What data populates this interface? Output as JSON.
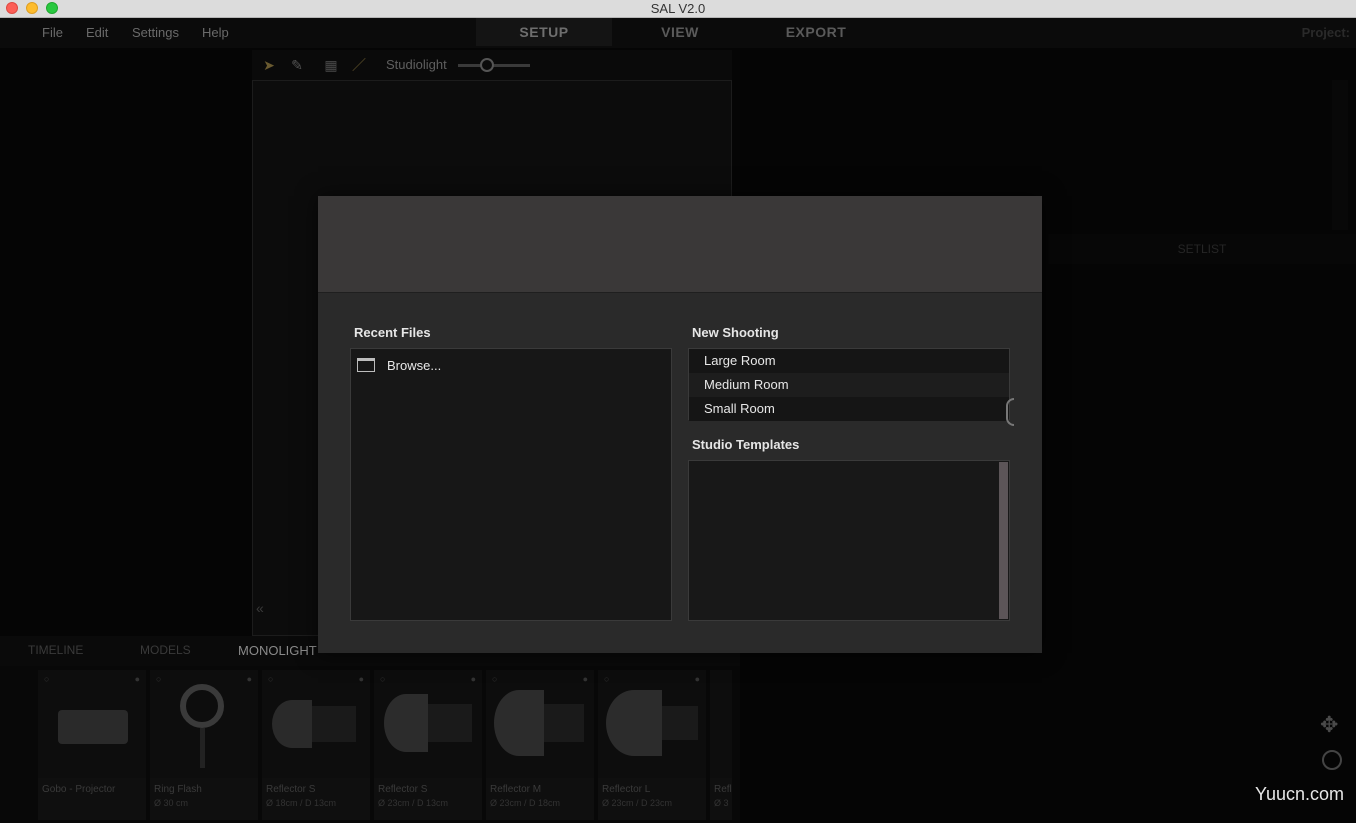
{
  "window": {
    "title": "SAL V2.0"
  },
  "menu": {
    "file": "File",
    "edit": "Edit",
    "settings": "Settings",
    "help": "Help"
  },
  "modes": {
    "setup": "SETUP",
    "view": "VIEW",
    "export": "EXPORT"
  },
  "header_right": {
    "project": "Project:"
  },
  "toolbar": {
    "studiolight": "Studiolight",
    "studiolight_level": 0.4
  },
  "setlist": {
    "label": "SETLIST"
  },
  "bottom_tabs": {
    "timeline": "TIMELINE",
    "models": "MODELS",
    "monolight": "MONOLIGHT"
  },
  "items": [
    {
      "name": "Gobo - Projector",
      "dims": ""
    },
    {
      "name": "Ring Flash",
      "dims": "Ø 30 cm"
    },
    {
      "name": "Reflector S",
      "dims": "Ø 18cm / D 13cm"
    },
    {
      "name": "Reflector S",
      "dims": "Ø 23cm / D 13cm"
    },
    {
      "name": "Reflector M",
      "dims": "Ø 23cm / D 18cm"
    },
    {
      "name": "Reflector L",
      "dims": "Ø 23cm / D 23cm"
    },
    {
      "name": "Refl",
      "dims": "Ø 3"
    }
  ],
  "dialog": {
    "recent_files": {
      "title": "Recent Files",
      "browse": "Browse..."
    },
    "new_shooting": {
      "title": "New Shooting",
      "options": [
        "Large Room",
        "Medium Room",
        "Small Room"
      ]
    },
    "studio_templates": {
      "title": "Studio Templates"
    }
  },
  "watermark": "Yuucn.com"
}
